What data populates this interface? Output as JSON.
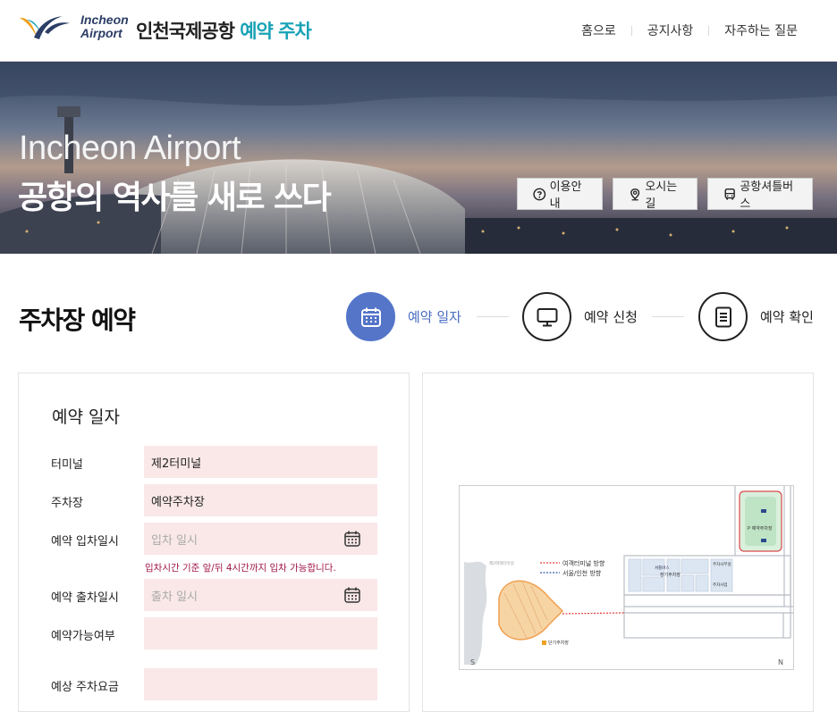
{
  "header": {
    "logo_line1": "Incheon",
    "logo_line2": "Airport",
    "brand_main": "인천국제공항",
    "brand_accent": "예약 주차",
    "nav": [
      "홈으로",
      "공지사항",
      "자주하는 질문"
    ]
  },
  "hero": {
    "title_en": "Incheon Airport",
    "title_ko": "공항의 역사를 새로 쓰다",
    "buttons": [
      {
        "label": "이용안내",
        "icon": "question-circle-icon"
      },
      {
        "label": "오시는길",
        "icon": "map-pin-icon"
      },
      {
        "label": "공항셔틀버스",
        "icon": "bus-icon"
      }
    ]
  },
  "page": {
    "title": "주차장 예약",
    "steps": [
      {
        "label": "예약 일자",
        "icon": "calendar-icon",
        "active": true
      },
      {
        "label": "예약 신청",
        "icon": "monitor-icon",
        "active": false
      },
      {
        "label": "예약 확인",
        "icon": "document-icon",
        "active": false
      }
    ]
  },
  "form": {
    "section_title": "예약 일자",
    "terminal_label": "터미널",
    "terminal_value": "제2터미널",
    "parking_label": "주차장",
    "parking_value": "예약주차장",
    "entry_label": "예약 입차일시",
    "entry_placeholder": "입차 일시",
    "entry_note": "입차시간 기준 앞/뒤 4시간까지 입차 가능합니다.",
    "exit_label": "예약 출차일시",
    "exit_placeholder": "출차 일시",
    "availability_label": "예약가능여부",
    "availability_value": "",
    "fee_label": "예상 주차요금",
    "fee_value": ""
  },
  "map": {
    "legend_terminal": "여객터미널 방향",
    "legend_seoul": "서울/인천 방향",
    "label_reserved": "P 예약주차장",
    "label_short": "단기주차장",
    "label_long": "장기주차장",
    "label_t2": "제2여객터미널",
    "compass_s": "S",
    "compass_n": "N",
    "label_office": "주차사무실",
    "label_shuttle": "셔틀버스",
    "label_parking_office": "주차사업"
  },
  "colors": {
    "accent_teal": "#18a2b5",
    "step_active": "#5575c9",
    "field_bg": "#fae8e8",
    "note_red": "#a0154a"
  }
}
